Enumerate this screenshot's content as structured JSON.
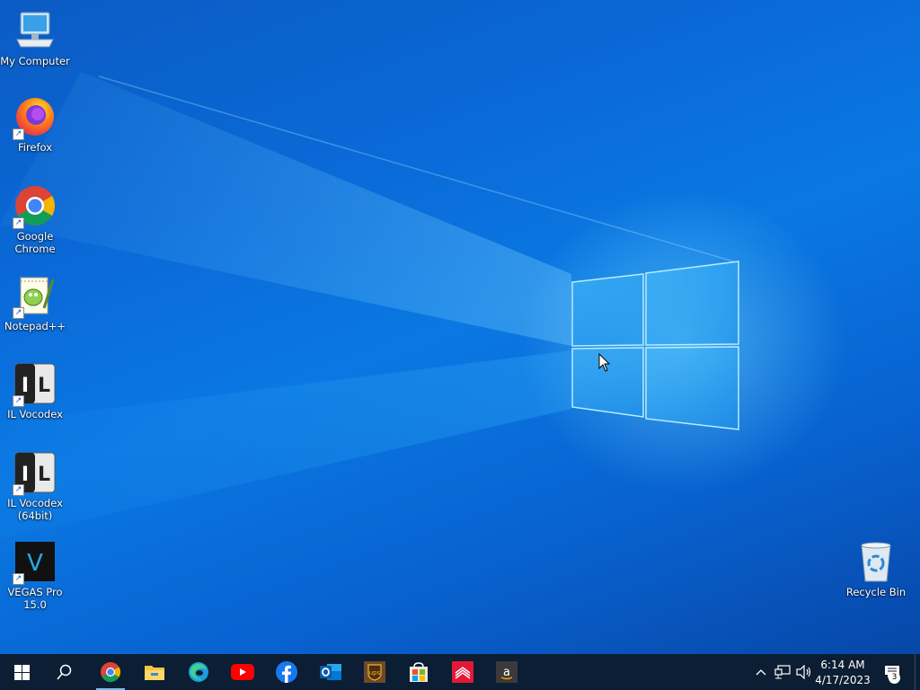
{
  "desktop": {
    "icons": [
      {
        "label": "My Computer",
        "icon": "computer-icon"
      },
      {
        "label": "Firefox",
        "icon": "firefox-icon"
      },
      {
        "label": "Google Chrome",
        "icon": "chrome-icon"
      },
      {
        "label": "Notepad++",
        "icon": "notepad-plus-plus-icon"
      },
      {
        "label": "IL Vocodex",
        "icon": "il-vocodex-icon"
      },
      {
        "label": "IL Vocodex (64bit)",
        "icon": "il-vocodex-64-icon"
      },
      {
        "label": "VEGAS Pro 15.0",
        "icon": "vegas-pro-icon"
      },
      {
        "label": "Recycle Bin",
        "icon": "recycle-bin-icon"
      }
    ]
  },
  "taskbar": {
    "start_icon": "windows-start-icon",
    "search_icon": "search-icon",
    "apps": [
      {
        "name": "Google Chrome",
        "icon": "chrome-icon",
        "active": true
      },
      {
        "name": "File Explorer",
        "icon": "file-explorer-icon",
        "active": false
      },
      {
        "name": "Microsoft Edge",
        "icon": "edge-icon",
        "active": false
      },
      {
        "name": "YouTube",
        "icon": "youtube-icon",
        "active": false
      },
      {
        "name": "Facebook",
        "icon": "facebook-icon",
        "active": false
      },
      {
        "name": "Outlook",
        "icon": "outlook-icon",
        "active": false
      },
      {
        "name": "UPS",
        "icon": "ups-icon",
        "active": false
      },
      {
        "name": "Microsoft Store",
        "icon": "store-icon",
        "active": false
      },
      {
        "name": "Bank of America",
        "icon": "bank-of-america-icon",
        "active": false
      },
      {
        "name": "Amazon",
        "icon": "amazon-icon",
        "active": false
      }
    ],
    "tray": {
      "time": "6:14 AM",
      "date": "4/17/2023",
      "notification_count": "3"
    },
    "ups_text": "ups",
    "amazon_text": "a",
    "vegas_text": "V",
    "vocodex_text": "I L"
  },
  "colors": {
    "desktop_blue": "#0a6ad8",
    "taskbar": "#0c1e33",
    "active_indicator": "#76b9ed"
  }
}
